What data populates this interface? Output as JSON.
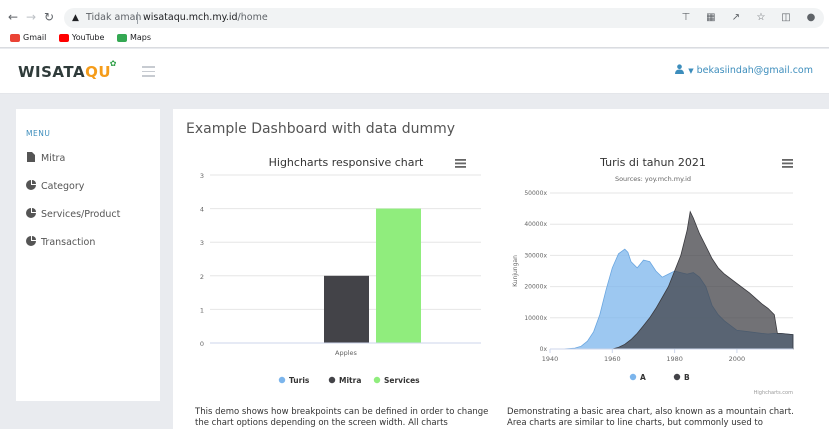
{
  "browser": {
    "security_label": "Tidak aman",
    "url_host": "wisataqu.mch.my.id",
    "url_path": "/home",
    "bookmarks": [
      {
        "label": "Gmail",
        "color": "#ea4335"
      },
      {
        "label": "YouTube",
        "color": "#ff0000"
      },
      {
        "label": "Maps",
        "color": "#34a853"
      }
    ]
  },
  "header": {
    "logo_main": "WISATA",
    "logo_q": "QU",
    "user_email": "bekasiindah@gmail.com",
    "accent": "#3c8dbc"
  },
  "sidebar": {
    "menu_title": "MENU",
    "items": [
      {
        "label": "Mitra",
        "icon": "file-icon"
      },
      {
        "label": "Category",
        "icon": "pie-chart-icon"
      },
      {
        "label": "Services/Product",
        "icon": "pie-chart-icon"
      },
      {
        "label": "Transaction",
        "icon": "pie-chart-icon"
      }
    ]
  },
  "main": {
    "title": "Example Dashboard with data dummy",
    "desc_left": "This demo shows how breakpoints can be defined in order to change the chart options depending on the screen width. All charts",
    "desc_right": "Demonstrating a basic area chart, also known as a mountain chart. Area charts are similar to line charts, but commonly used to visualize"
  },
  "chart_data": [
    {
      "type": "bar",
      "title": "Highcharts responsive chart",
      "categories": [
        "Apples"
      ],
      "ylim": [
        0,
        3
      ],
      "y_ticks": [
        "0",
        "1",
        "2",
        "3",
        "4",
        "5"
      ],
      "series": [
        {
          "name": "Turis",
          "values": [
            0
          ],
          "color": "#7cb5ec"
        },
        {
          "name": "Mitra",
          "values": [
            2
          ],
          "color": "#434348"
        },
        {
          "name": "Services",
          "values": [
            4
          ],
          "color": "#90ed7d"
        }
      ],
      "legend": "bottom-center",
      "grid": true
    },
    {
      "type": "area",
      "title": "Turis di tahun 2021",
      "subtitle": "Sources: yoy.mch.my.id",
      "ylabel": "Kunjungan",
      "x_ticks": [
        "1940",
        "1960",
        "1980",
        "2000"
      ],
      "y_ticks": [
        "0x",
        "10000x",
        "20000x",
        "30000x",
        "40000x",
        "50000x"
      ],
      "xlim": [
        1940,
        2018
      ],
      "ylim": [
        0,
        50000
      ],
      "series": [
        {
          "name": "A",
          "color": "#7cb5ec",
          "x": [
            1940,
            1944,
            1948,
            1950,
            1952,
            1954,
            1956,
            1958,
            1960,
            1962,
            1964,
            1965,
            1966,
            1968,
            1970,
            1972,
            1974,
            1976,
            1978,
            1980,
            1982,
            1984,
            1986,
            1988,
            1990,
            1992,
            1994,
            1996,
            2000,
            2004,
            2008,
            2010,
            2012,
            2014,
            2016,
            2018
          ],
          "y": [
            0,
            0,
            300,
            900,
            2500,
            5500,
            11000,
            19000,
            26000,
            30500,
            32000,
            31000,
            28000,
            26000,
            28500,
            28000,
            25000,
            23000,
            24000,
            25000,
            24500,
            24000,
            24500,
            23000,
            20000,
            14000,
            11000,
            9000,
            6000,
            5500,
            5000,
            4800,
            5000,
            5000,
            4800,
            4600
          ]
        },
        {
          "name": "B",
          "color": "#434348",
          "x": [
            1940,
            1944,
            1948,
            1952,
            1956,
            1960,
            1962,
            1964,
            1966,
            1968,
            1970,
            1972,
            1974,
            1976,
            1978,
            1980,
            1982,
            1984,
            1985,
            1986,
            1988,
            1990,
            1992,
            1994,
            1996,
            2000,
            2004,
            2008,
            2010,
            2012,
            2013,
            2014,
            2016,
            2018
          ],
          "y": [
            0,
            0,
            0,
            0,
            0,
            0,
            500,
            1500,
            3000,
            5000,
            7500,
            10000,
            13000,
            16500,
            20000,
            25000,
            30000,
            38000,
            44000,
            42000,
            37000,
            33000,
            29000,
            26000,
            24000,
            21000,
            18000,
            14500,
            13000,
            11000,
            5000,
            5000,
            4800,
            4600
          ]
        }
      ],
      "legend": "bottom-center",
      "credit": "Highcharts.com"
    }
  ]
}
